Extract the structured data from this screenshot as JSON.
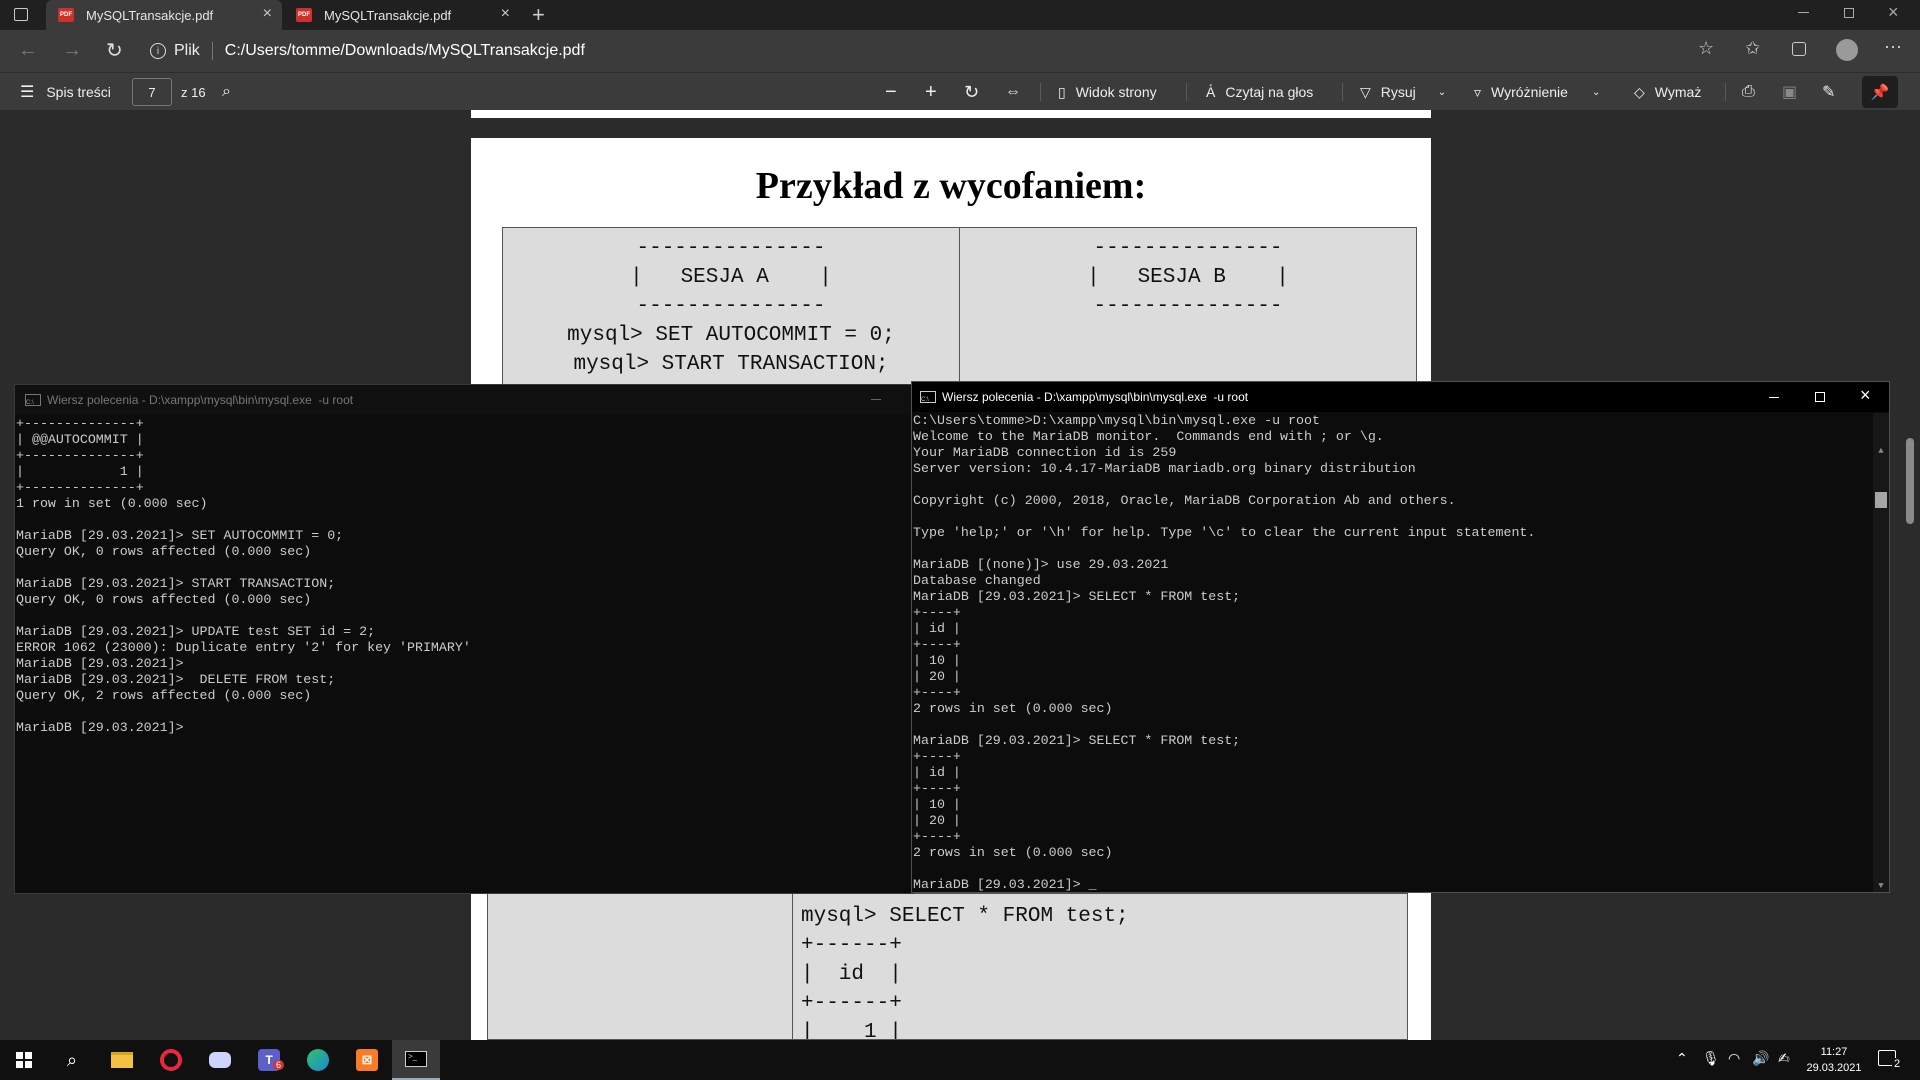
{
  "tabs": [
    {
      "title": "MySQLTransakcje.pdf"
    },
    {
      "title": "MySQLTransakcje.pdf"
    }
  ],
  "address": {
    "scheme": "Plik",
    "url": "C:/Users/tomme/Downloads/MySQLTransakcje.pdf"
  },
  "pdf_toolbar": {
    "toc": "Spis treści",
    "page": "7",
    "of": "z 16",
    "page_view": "Widok strony",
    "read_aloud": "Czytaj na głos",
    "draw": "Rysuj",
    "highlight": "Wyróżnienie",
    "erase": "Wymaż"
  },
  "pdf": {
    "heading": "Przykład z wycofaniem:",
    "session_a": [
      "---------------",
      "|   SESJA A    |",
      "---------------",
      "mysql> SET AUTOCOMMIT = 0;",
      "mysql> START TRANSACTION;"
    ],
    "session_b": [
      "---------------",
      "|   SESJA B    |",
      "---------------"
    ],
    "lower": [
      "mysql> SELECT * FROM test;",
      "+------+",
      "|  id  |",
      "+------+",
      "|    1 |"
    ]
  },
  "cmd_left": {
    "title": "Wiersz polecenia - D:\\xampp\\mysql\\bin\\mysql.exe  -u root",
    "lines": [
      "+--------------+",
      "| @@AUTOCOMMIT |",
      "+--------------+",
      "|            1 |",
      "+--------------+",
      "1 row in set (0.000 sec)",
      "",
      "MariaDB [29.03.2021]> SET AUTOCOMMIT = 0;",
      "Query OK, 0 rows affected (0.000 sec)",
      "",
      "MariaDB [29.03.2021]> START TRANSACTION;",
      "Query OK, 0 rows affected (0.000 sec)",
      "",
      "MariaDB [29.03.2021]> UPDATE test SET id = 2;",
      "ERROR 1062 (23000): Duplicate entry '2' for key 'PRIMARY'",
      "MariaDB [29.03.2021]>",
      "MariaDB [29.03.2021]>  DELETE FROM test;",
      "Query OK, 2 rows affected (0.000 sec)",
      "",
      "MariaDB [29.03.2021]>"
    ]
  },
  "cmd_right": {
    "title": "Wiersz polecenia - D:\\xampp\\mysql\\bin\\mysql.exe  -u root",
    "lines": [
      "C:\\Users\\tomme>D:\\xampp\\mysql\\bin\\mysql.exe -u root",
      "Welcome to the MariaDB monitor.  Commands end with ; or \\g.",
      "Your MariaDB connection id is 259",
      "Server version: 10.4.17-MariaDB mariadb.org binary distribution",
      "",
      "Copyright (c) 2000, 2018, Oracle, MariaDB Corporation Ab and others.",
      "",
      "Type 'help;' or '\\h' for help. Type '\\c' to clear the current input statement.",
      "",
      "MariaDB [(none)]> use 29.03.2021",
      "Database changed",
      "MariaDB [29.03.2021]> SELECT * FROM test;",
      "+----+",
      "| id |",
      "+----+",
      "| 10 |",
      "| 20 |",
      "+----+",
      "2 rows in set (0.000 sec)",
      "",
      "MariaDB [29.03.2021]> SELECT * FROM test;",
      "+----+",
      "| id |",
      "+----+",
      "| 10 |",
      "| 20 |",
      "+----+",
      "2 rows in set (0.000 sec)",
      "",
      "MariaDB [29.03.2021]> _"
    ]
  },
  "taskbar": {
    "time": "11:27",
    "date": "29.03.2021",
    "teams_badge": "6",
    "notif_count": "2"
  },
  "colors": {
    "chrome": "#3b3b3b",
    "cmd_bg": "#0c0c0c",
    "cmd_text": "#cccccc",
    "taskbar": "#101010"
  }
}
